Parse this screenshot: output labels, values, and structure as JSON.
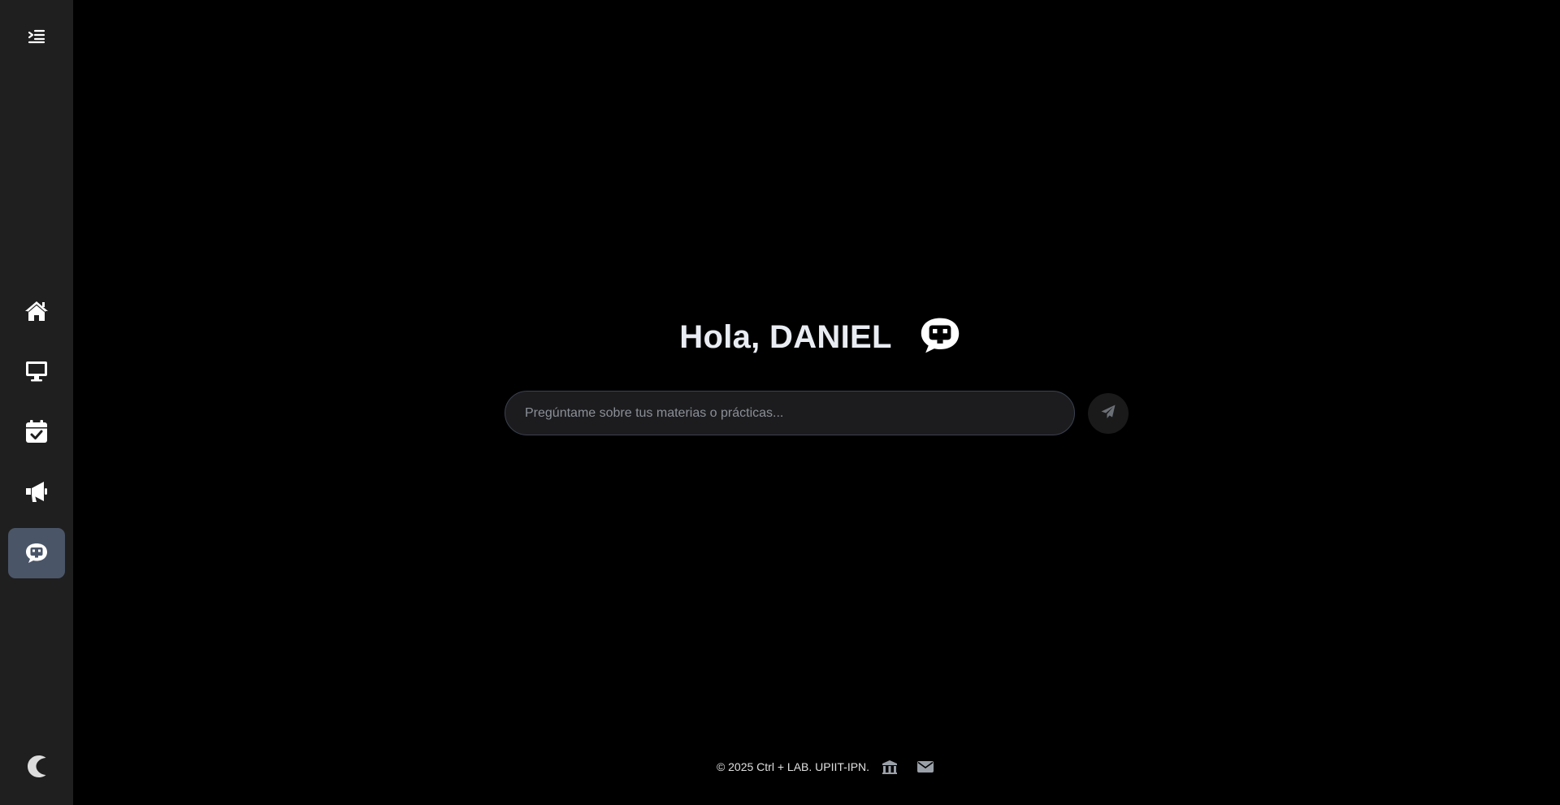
{
  "sidebar": {
    "items": [
      {
        "name": "menu-toggle",
        "icon": "indent-menu-icon"
      },
      {
        "name": "home",
        "icon": "home-icon"
      },
      {
        "name": "devices",
        "icon": "monitor-icon"
      },
      {
        "name": "calendar",
        "icon": "calendar-check-icon"
      },
      {
        "name": "announcements",
        "icon": "megaphone-icon"
      },
      {
        "name": "chatbot",
        "icon": "chatbot-icon",
        "active": true
      },
      {
        "name": "theme",
        "icon": "moon-icon"
      }
    ],
    "active_color": "#4a5568"
  },
  "main": {
    "greeting": "Hola, DANIEL",
    "greeting_icon": "chatbot-icon",
    "chat": {
      "placeholder": "Pregúntame sobre tus materias o prácticas...",
      "value": ""
    },
    "send_icon": "paper-plane-icon"
  },
  "footer": {
    "text": "© 2025 Ctrl + LAB. UPIIT-IPN.",
    "icons": [
      "institution-icon",
      "envelope-icon"
    ]
  },
  "colors": {
    "background": "#000000",
    "sidebar": "#1f1f1f",
    "input_border": "#3a4150"
  }
}
